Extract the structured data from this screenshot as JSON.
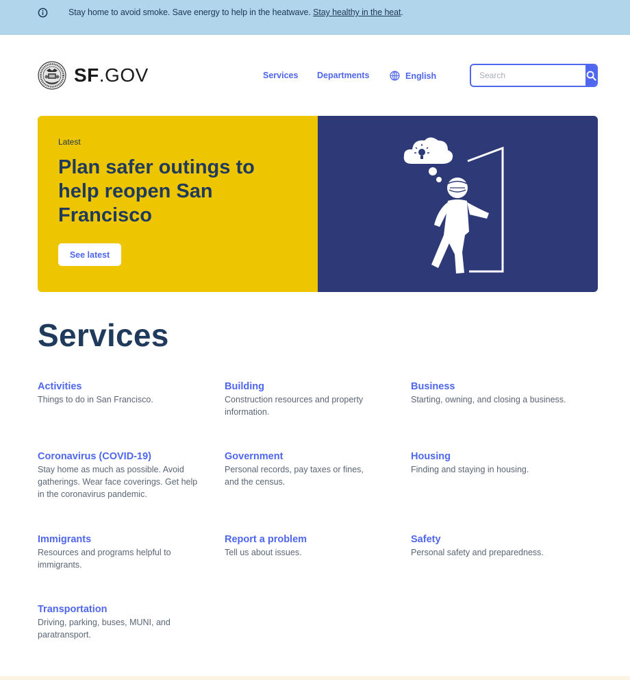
{
  "alert": {
    "icon": "info-icon",
    "text": "Stay home to avoid smoke. Save energy to help in the heatwave. ",
    "link_text": "Stay healthy in the heat",
    "trailing": "."
  },
  "header": {
    "logo_bold": "SF",
    "logo_rest": ".GOV",
    "nav": [
      {
        "label": "Services"
      },
      {
        "label": "Departments"
      },
      {
        "label": "English",
        "icon": "globe-icon"
      }
    ],
    "search": {
      "placeholder": "Search",
      "value": "",
      "button_icon": "search-icon"
    }
  },
  "hero": {
    "eyebrow": "Latest",
    "title": "Plan safer outings to help reopen San Francisco",
    "button_label": "See latest",
    "illustration": "person-with-mask-exiting-door-with-idea-cloud",
    "colors": {
      "left_bg": "#edc501",
      "right_bg": "#2e3a78"
    }
  },
  "services": {
    "title": "Services",
    "items": [
      {
        "name": "Activities",
        "desc": "Things to do in San Francisco."
      },
      {
        "name": "Building",
        "desc": "Construction resources and property information."
      },
      {
        "name": "Business",
        "desc": "Starting, owning, and closing a business."
      },
      {
        "name": "Coronavirus (COVID-19)",
        "desc": "Stay home as much as possible. Avoid gatherings. Wear face coverings. Get help in the coronavirus pandemic."
      },
      {
        "name": "Government",
        "desc": "Personal records, pay taxes or fines, and the census."
      },
      {
        "name": "Housing",
        "desc": "Finding and staying in housing."
      },
      {
        "name": "Immigrants",
        "desc": "Resources and programs helpful to immigrants."
      },
      {
        "name": "Report a problem",
        "desc": "Tell us about issues."
      },
      {
        "name": "Safety",
        "desc": "Personal safety and preparedness."
      },
      {
        "name": "Transportation",
        "desc": "Driving, parking, buses, MUNI, and paratransport."
      }
    ]
  },
  "colors": {
    "accent": "#4f66ee",
    "heading": "#1f3a5a",
    "alert_bg": "#b1d6ec"
  }
}
